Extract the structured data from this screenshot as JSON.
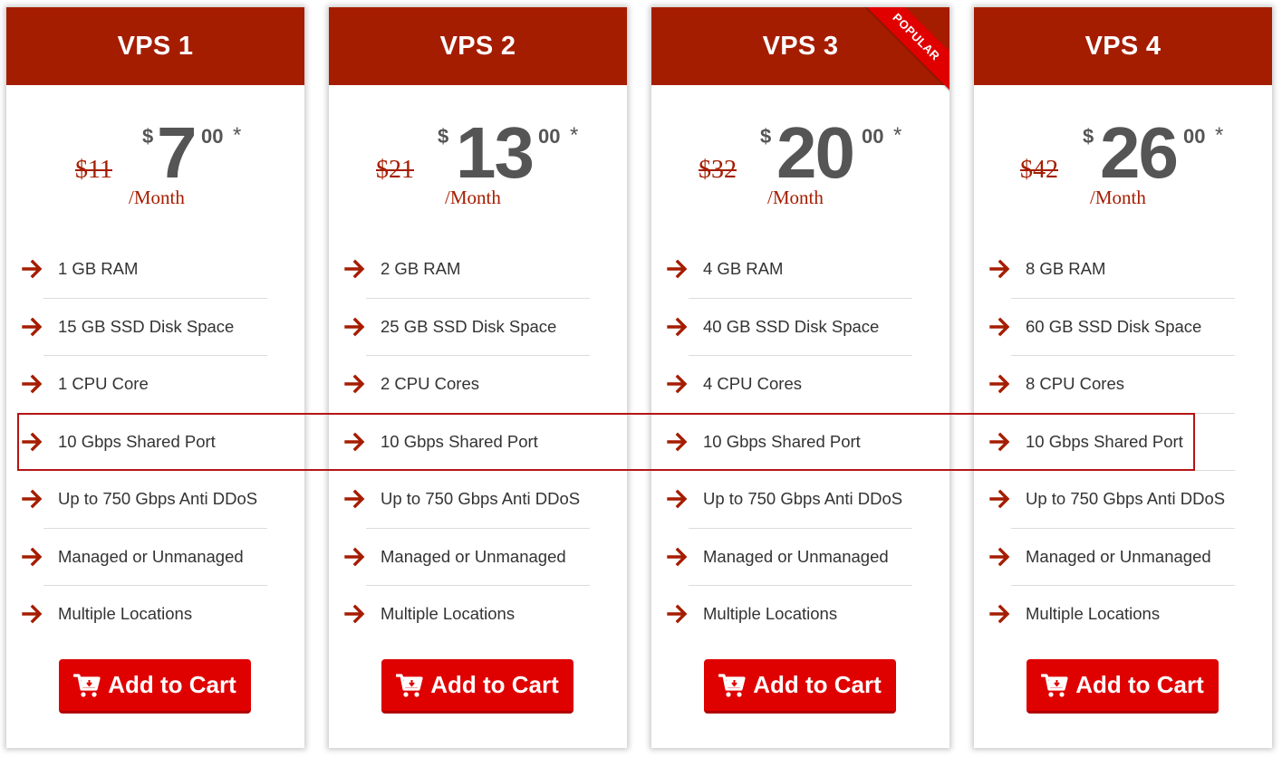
{
  "colors": {
    "header_bg": "#a51d00",
    "accent_red": "#a51d00",
    "button_bg": "#df0000",
    "ribbon_bg": "#e00000",
    "price_text": "#555555",
    "highlight_border": "#b51515"
  },
  "plans": [
    {
      "name": "VPS 1",
      "old_price": "$11",
      "currency": "$",
      "amount": "7",
      "cents": "00",
      "asterisk": "*",
      "period": "/Month",
      "ribbon": null,
      "features": [
        "1 GB RAM",
        "15 GB SSD Disk Space",
        "1 CPU Core",
        "10 Gbps Shared Port",
        "Up to 750 Gbps Anti DDoS",
        "Managed or Unmanaged",
        "Multiple Locations"
      ],
      "button_label": "Add to Cart",
      "button_icon": "cart-plus-icon"
    },
    {
      "name": "VPS 2",
      "old_price": "$21",
      "currency": "$",
      "amount": "13",
      "cents": "00",
      "asterisk": "*",
      "period": "/Month",
      "ribbon": null,
      "features": [
        "2 GB RAM",
        "25 GB SSD Disk Space",
        "2 CPU Cores",
        "10 Gbps Shared Port",
        "Up to 750 Gbps Anti DDoS",
        "Managed or Unmanaged",
        "Multiple Locations"
      ],
      "button_label": "Add to Cart",
      "button_icon": "cart-plus-icon"
    },
    {
      "name": "VPS 3",
      "old_price": "$32",
      "currency": "$",
      "amount": "20",
      "cents": "00",
      "asterisk": "*",
      "period": "/Month",
      "ribbon": "POPULAR",
      "features": [
        "4 GB RAM",
        "40 GB SSD Disk Space",
        "4 CPU Cores",
        "10 Gbps Shared Port",
        "Up to 750 Gbps Anti DDoS",
        "Managed or Unmanaged",
        "Multiple Locations"
      ],
      "button_label": "Add to Cart",
      "button_icon": "cart-plus-icon"
    },
    {
      "name": "VPS 4",
      "old_price": "$42",
      "currency": "$",
      "amount": "26",
      "cents": "00",
      "asterisk": "*",
      "period": "/Month",
      "ribbon": null,
      "features": [
        "8 GB RAM",
        "60 GB SSD Disk Space",
        "8 CPU Cores",
        "10 Gbps Shared Port",
        "Up to 750 Gbps Anti DDoS",
        "Managed or Unmanaged",
        "Multiple Locations"
      ],
      "button_label": "Add to Cart",
      "button_icon": "cart-plus-icon"
    }
  ],
  "highlight": {
    "row_label": "10 Gbps Shared Port"
  },
  "feature_icon": "arrow-right-icon"
}
